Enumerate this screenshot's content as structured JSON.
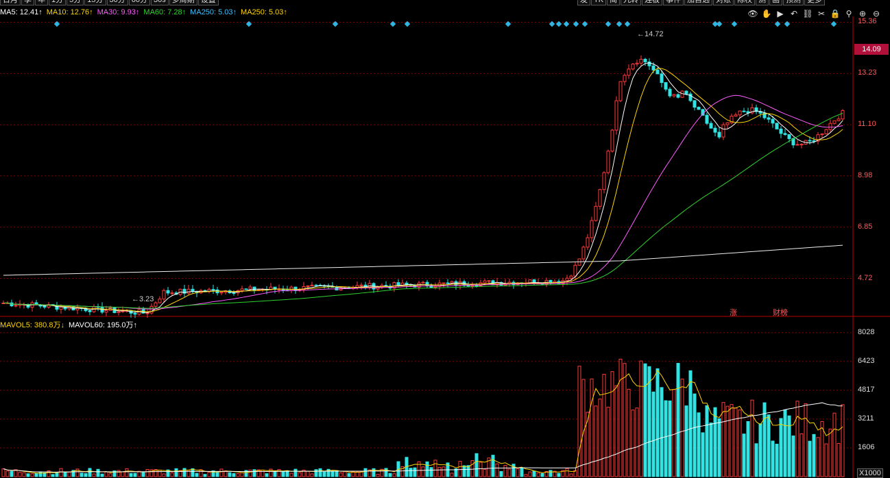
{
  "toolbar_left": [
    "日月",
    "季",
    "年",
    "1分",
    "5分",
    "15分",
    "30分",
    "60分",
    "30s",
    "多周期",
    "设置"
  ],
  "toolbar_right": [
    "发",
    "TK",
    "简",
    "九转",
    "连板",
    "事件",
    "加自选",
    "对账",
    "除权",
    "测",
    "画",
    "预测",
    "更多"
  ],
  "ma_legend": [
    {
      "label": "MA5: 12.41↑",
      "color": "#ffffff"
    },
    {
      "label": "MA10: 12.76↑",
      "color": "#ffd500"
    },
    {
      "label": "MA30: 9.93↑",
      "color": "#ff5cff"
    },
    {
      "label": "MA60: 7.28↑",
      "color": "#2fd32f"
    },
    {
      "label": "MA250: 5.03↑",
      "color": "#3cc0ff"
    },
    {
      "label": "MA250: 5.03↑",
      "color": "#ffd500"
    }
  ],
  "vol_legend": [
    {
      "label": "MAVOL5: 380.8万↓",
      "color": "#ffd500"
    },
    {
      "label": "MAVOL60: 195.0万↑",
      "color": "#ffffff"
    }
  ],
  "price_axis": [
    "15.36",
    "13.23",
    "11.10",
    "8.98",
    "6.85",
    "4.72"
  ],
  "current_price": "14.09",
  "vol_axis": [
    "8028",
    "6423",
    "4817",
    "3211",
    "1606"
  ],
  "vol_unit": "X1000",
  "annotations": {
    "high": "14.72",
    "low": "3.23",
    "zhang": "涨",
    "caibang": "财榜"
  },
  "icons": [
    "eye-icon",
    "hand-icon",
    "play-icon",
    "return-icon",
    "link-icon",
    "scissors-icon",
    "lock-icon",
    "pin-icon",
    "zoom-in-icon",
    "zoom-out-icon"
  ],
  "chart_data": {
    "type": "candlestick",
    "ylim": [
      3.2,
      15.6
    ],
    "yticks": [
      15.36,
      13.23,
      11.1,
      8.98,
      6.85,
      4.72
    ],
    "vol_ylim": [
      0,
      8400
    ],
    "vol_yticks": [
      8028,
      6423,
      4817,
      3211,
      1606
    ],
    "grid": true,
    "legend": "top-left"
  }
}
